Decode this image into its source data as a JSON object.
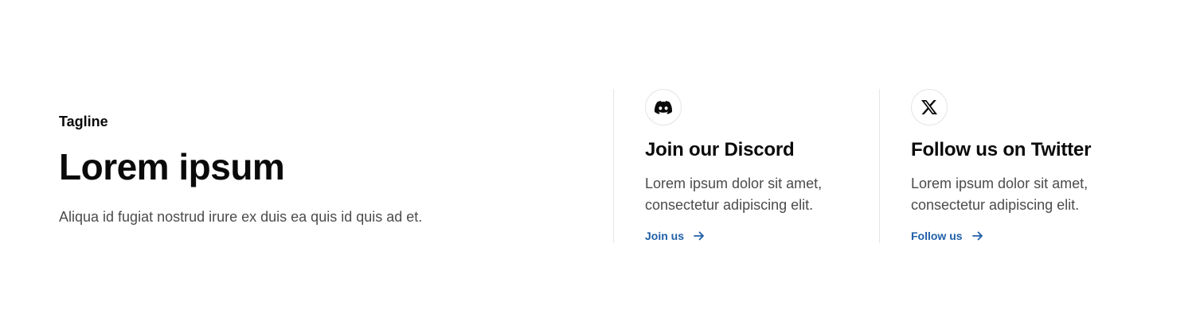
{
  "intro": {
    "tagline": "Tagline",
    "heading": "Lorem ipsum",
    "description": "Aliqua id fugiat nostrud irure ex duis ea quis id quis ad et."
  },
  "cards": [
    {
      "icon": "discord-icon",
      "title": "Join our Discord",
      "text_line1": "Lorem ipsum dolor sit amet,",
      "text_line2": "consectetur adipiscing elit.",
      "link_label": "Join us"
    },
    {
      "icon": "x-twitter-icon",
      "title": "Follow us on Twitter",
      "text_line1": "Lorem ipsum dolor sit amet,",
      "text_line2": "consectetur adipiscing elit.",
      "link_label": "Follow us"
    }
  ],
  "colors": {
    "link": "#1f5fa8",
    "heading": "#0a0a0a",
    "body_text": "#4b4b4b",
    "divider": "#e6e6e6"
  }
}
